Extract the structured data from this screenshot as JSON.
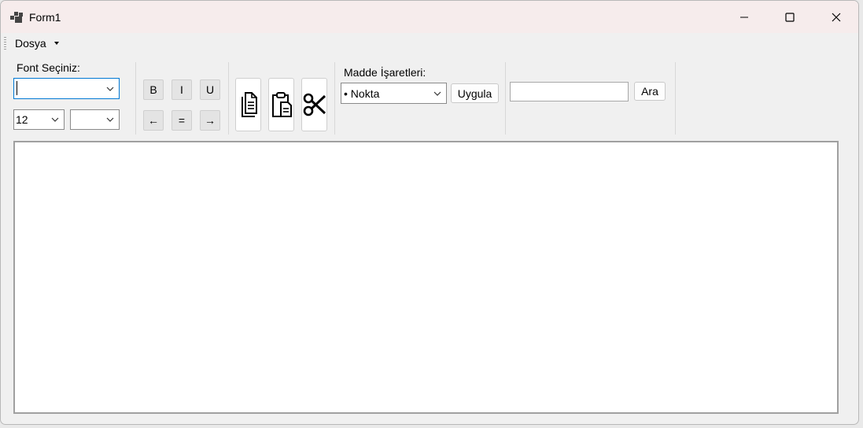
{
  "window": {
    "title": "Form1"
  },
  "menu": {
    "dosya_label": "Dosya"
  },
  "font_section": {
    "label": "Font Seçiniz:",
    "font_combo_value": "",
    "size_combo_value": "12",
    "third_combo_value": ""
  },
  "format_buttons": {
    "bold": "B",
    "italic": "I",
    "underline": "U"
  },
  "align_buttons": {
    "left": "←",
    "center": "=",
    "right": "→"
  },
  "bullets": {
    "label": "Madde İşaretleri:",
    "combo_value": "• Nokta",
    "apply_label": "Uygula"
  },
  "search": {
    "input_value": "",
    "button_label": "Ara"
  },
  "editor": {
    "text": ""
  }
}
